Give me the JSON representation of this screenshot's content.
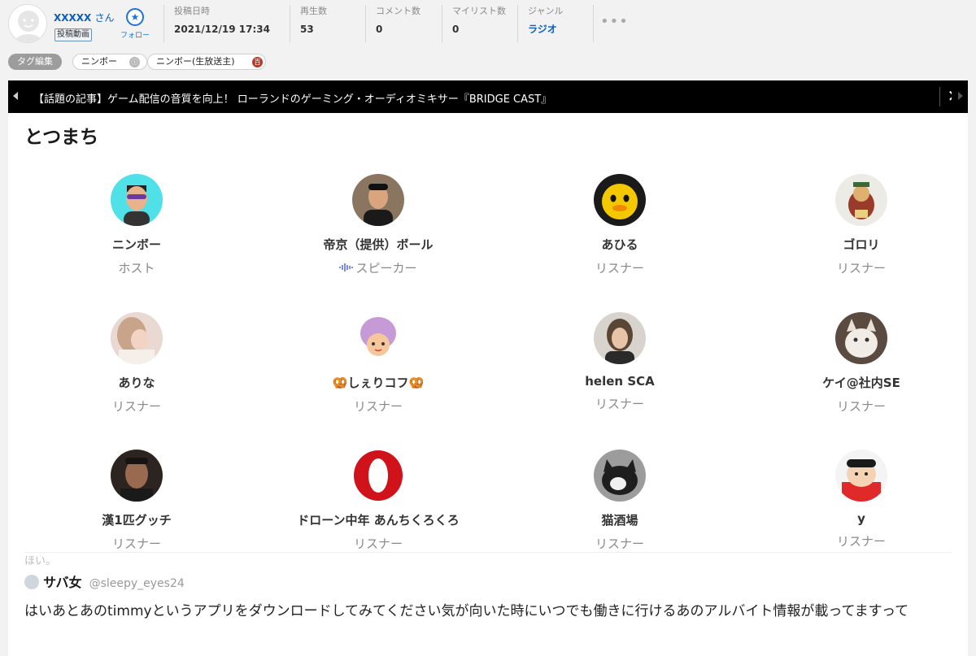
{
  "header": {
    "user_name": "XXXXX",
    "user_suffix": "さん",
    "posted_badge": "投稿動画",
    "follow_label": "フォロー",
    "stats": {
      "posted": {
        "label": "投稿日時",
        "value": "2021/12/19 17:34"
      },
      "views": {
        "label": "再生数",
        "value": "53"
      },
      "comments": {
        "label": "コメント数",
        "value": "0"
      },
      "mylist": {
        "label": "マイリスト数",
        "value": "0"
      },
      "genre": {
        "label": "ジャンル",
        "value": "ラジオ"
      }
    },
    "more_label": "•••"
  },
  "tags": {
    "edit_label": "タグ編集",
    "items": [
      {
        "label": "ニンボー"
      },
      {
        "label": "ニンボー(生放送主)"
      }
    ],
    "dict_icon_label": "百"
  },
  "news": {
    "text": "【話題の記事】ゲーム配信の音質を向上！ ローランドのゲーミング・オーディオミキサー『BRIDGE CAST』",
    "close_label": "✕"
  },
  "room": {
    "title": "とつまち",
    "members": [
      {
        "name": "ニンボー",
        "role": "ホスト"
      },
      {
        "name": "帝京（提供）ボール",
        "role": "スピーカー"
      },
      {
        "name": "あひる",
        "role": "リスナー"
      },
      {
        "name": "ゴロリ",
        "role": "リスナー"
      },
      {
        "name": "ありな",
        "role": "リスナー"
      },
      {
        "name": "🥨しぇりコフ🥨",
        "role": "リスナー"
      },
      {
        "name": "helen SCA",
        "role": "リスナー"
      },
      {
        "name": "ケイ@社内SE",
        "role": "リスナー"
      },
      {
        "name": "漢1匹グッチ",
        "role": "リスナー"
      },
      {
        "name": "ドローン中年 あんちくろくろ",
        "role": "リスナー"
      },
      {
        "name": "猫酒場",
        "role": "リスナー"
      },
      {
        "name": "y",
        "role": "リスナー"
      }
    ]
  },
  "comment": {
    "cut_text": "ほい。",
    "author": "サバ女",
    "handle": "@sleepy_eyes24",
    "body": "はいあとあのtimmyというアプリをダウンロードしてみてください気が向いた時にいつでも働きに行けるあのアルバイト情報が載ってますって"
  },
  "colors": {
    "link": "#0a5dc2",
    "news_bar": "#000000",
    "dict_icon": "#c0392b"
  }
}
